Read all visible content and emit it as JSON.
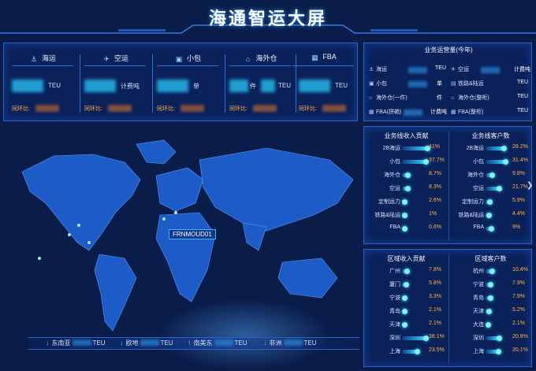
{
  "header": {
    "title": "海通智运大屏"
  },
  "top_modules": [
    {
      "label": "海运",
      "icon": "ship-icon",
      "unit": "TEU",
      "yoy_label": "同环比:"
    },
    {
      "label": "空运",
      "icon": "plane-icon",
      "unit": "计费吨",
      "yoy_label": "同环比:"
    },
    {
      "label": "小包",
      "icon": "package-icon",
      "unit": "单",
      "yoy_label": "同环比:"
    },
    {
      "label": "海外仓",
      "icon": "warehouse-icon",
      "unit": "件",
      "yoy_label": "同环比:",
      "unit2": "TEU"
    },
    {
      "label": "FBA",
      "icon": "fba-icon",
      "unit": "TEU",
      "yoy_label": "同环比:"
    }
  ],
  "operations": {
    "title": "业务运营量(今年)",
    "items": [
      {
        "label": "海运",
        "unit": "TEU"
      },
      {
        "label": "空运",
        "unit": "计费吨"
      },
      {
        "label": "小包",
        "unit": "单"
      },
      {
        "label": "铁路&陆运",
        "unit": "TEU"
      },
      {
        "label": "海外仓(一件)",
        "unit": "件"
      },
      {
        "label": "海外仓(整柜)",
        "unit": "TEU"
      },
      {
        "label": "FBA(拼箱)",
        "unit": "计费吨"
      },
      {
        "label": "FBA(整柜)",
        "unit": "TEU"
      }
    ]
  },
  "growth": {
    "left_title": "业务线收入贡献",
    "right_title": "业务线客户数",
    "left": [
      {
        "label": "2B海运",
        "value": "41%",
        "pct": 41
      },
      {
        "label": "小包",
        "value": "37.7%",
        "pct": 37.7
      },
      {
        "label": "海外仓",
        "value": "8.7%",
        "pct": 8.7
      },
      {
        "label": "空运",
        "value": "8.3%",
        "pct": 8.3
      },
      {
        "label": "定制运力",
        "value": "2.6%",
        "pct": 2.6
      },
      {
        "label": "铁路&陆运",
        "value": "1%",
        "pct": 1
      },
      {
        "label": "FBA",
        "value": "0.6%",
        "pct": 0.6
      }
    ],
    "right": [
      {
        "label": "2B海运",
        "value": "28.2%",
        "pct": 28.2
      },
      {
        "label": "小包",
        "value": "31.4%",
        "pct": 31.4
      },
      {
        "label": "海外仓",
        "value": "9.8%",
        "pct": 9.8
      },
      {
        "label": "空运",
        "value": "21.7%",
        "pct": 21.7
      },
      {
        "label": "定制运力",
        "value": "5.9%",
        "pct": 5.9
      },
      {
        "label": "铁路&陆运",
        "value": "4.4%",
        "pct": 4.4
      },
      {
        "label": "FBA",
        "value": "9%",
        "pct": 9
      }
    ]
  },
  "region": {
    "left_title": "区域收入贡献",
    "right_title": "区域客户数",
    "left": [
      {
        "label": "广州",
        "value": "7.8%",
        "pct": 7.8
      },
      {
        "label": "厦门",
        "value": "5.8%",
        "pct": 5.8
      },
      {
        "label": "宁波",
        "value": "3.3%",
        "pct": 3.3
      },
      {
        "label": "青岛",
        "value": "2.1%",
        "pct": 2.1
      },
      {
        "label": "天津",
        "value": "2.1%",
        "pct": 2.1
      },
      {
        "label": "深圳",
        "value": "38.1%",
        "pct": 38.1
      },
      {
        "label": "上海",
        "value": "23.5%",
        "pct": 23.5
      }
    ],
    "right": [
      {
        "label": "杭州",
        "value": "10.4%",
        "pct": 10.4
      },
      {
        "label": "宁波",
        "value": "7.9%",
        "pct": 7.9
      },
      {
        "label": "青岛",
        "value": "7.9%",
        "pct": 7.9
      },
      {
        "label": "天津",
        "value": "5.2%",
        "pct": 5.2
      },
      {
        "label": "大连",
        "value": "2.1%",
        "pct": 2.1
      },
      {
        "label": "深圳",
        "value": "20.8%",
        "pct": 20.8
      },
      {
        "label": "上海",
        "value": "20.1%",
        "pct": 20.1
      }
    ]
  },
  "map": {
    "popup_label": "FRNMOUD01"
  },
  "routes": [
    {
      "direction": "down",
      "label": "东南亚",
      "unit": "TEU",
      "color": "#28d6c8"
    },
    {
      "direction": "down",
      "label": "欧地",
      "unit": "TEU",
      "color": "#28d6c8"
    },
    {
      "direction": "up",
      "label": "南美东",
      "unit": "TEU",
      "color": "#ffb347"
    },
    {
      "direction": "down",
      "label": "非洲",
      "unit": "TEU",
      "color": "#28d6c8"
    }
  ]
}
